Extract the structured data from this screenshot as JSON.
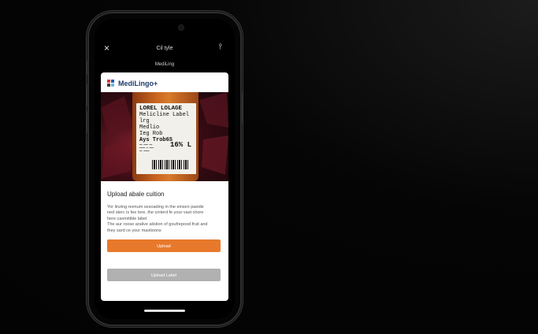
{
  "topbar": {
    "close_icon": "×",
    "title": "Cil tyle",
    "menu_icon": "⫯"
  },
  "subtitle": "MediLing",
  "brand": {
    "name": "MediLingo+",
    "colors": [
      "#d9363e",
      "#1f5fbf",
      "#3a3a3a",
      "#6bb7e8"
    ]
  },
  "label_image": {
    "line1": "LOREL LOLAGE",
    "line2": "Melicline Label lrg",
    "line3": "Medlio",
    "line4": "Ieg Rob",
    "line5": "Ays Trob6S",
    "rx": "16% L"
  },
  "section_title": "Upload abale cuition",
  "description": [
    "Yor linzing reenum sesoading in the einsen paeide",
    "ned sterc is fee tore, the cinterd fe your vast chore",
    "here canmitible label",
    "The aur roose aralive alistion of goufrepood fruit and",
    "they sard ce your mastioons"
  ],
  "buttons": {
    "upload": "Upload",
    "upload_label": "Upload Label"
  },
  "colors": {
    "accent": "#e8792c",
    "secondary": "#b1b1b1",
    "brand_text": "#1f3b6a"
  }
}
